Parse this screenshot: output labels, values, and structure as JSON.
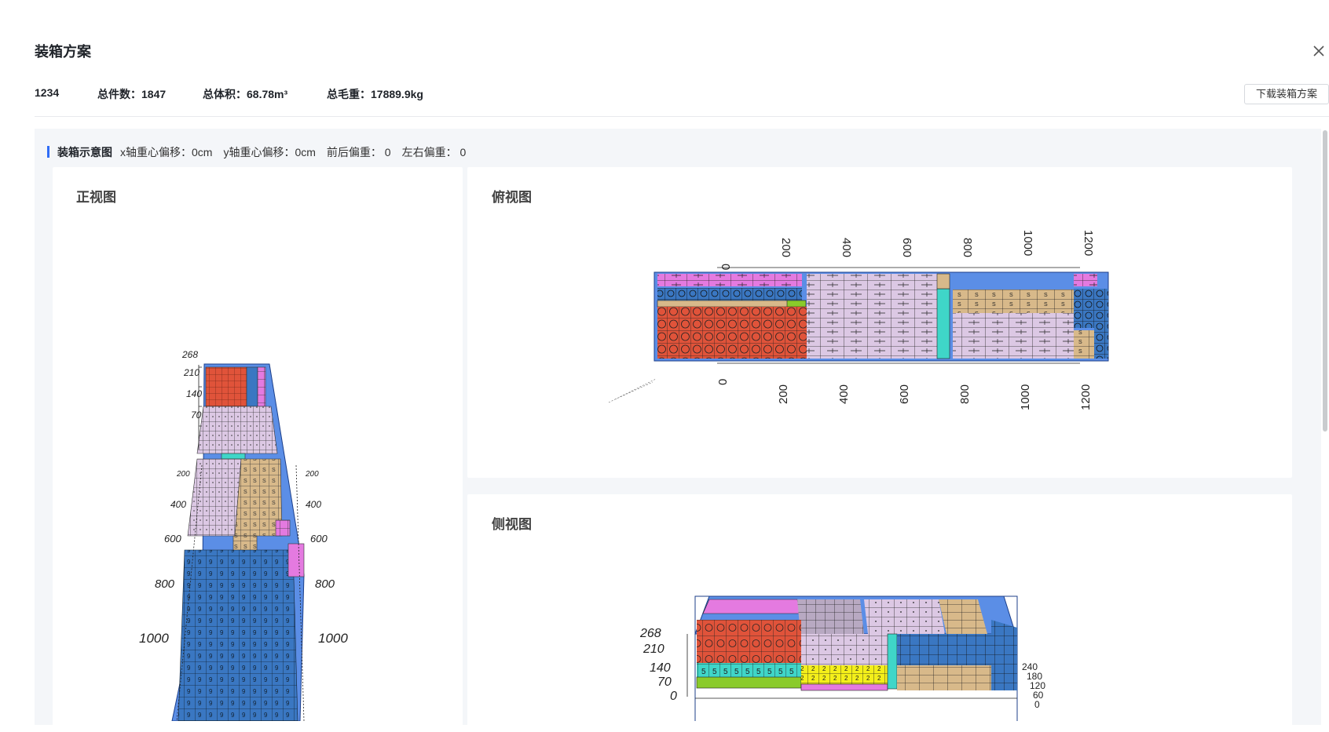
{
  "dialog": {
    "title": "装箱方案",
    "download_label": "下载装箱方案"
  },
  "stats": {
    "id": "1234",
    "total_pieces": "总件数：1847",
    "total_volume": "总体积：68.78m³",
    "gross_weight": "总毛重：17889.9kg"
  },
  "diagram_section": {
    "heading": "装箱示意图",
    "x_offset": "x轴重心偏移：0cm",
    "y_offset": "y轴重心偏移：0cm",
    "front_back": "前后偏重： 0",
    "left_right": "左右偏重： 0"
  },
  "views": {
    "front": "正视图",
    "top": "俯视图",
    "side": "侧视图"
  },
  "axis_labels": {
    "length": [
      "0",
      "200",
      "400",
      "600",
      "800",
      "1000",
      "1200"
    ],
    "height": [
      "268",
      "210",
      "140",
      "70",
      "0"
    ],
    "width": [
      "240",
      "180",
      "120",
      "60",
      "0"
    ]
  },
  "colors": {
    "accent": "#2f6cf6",
    "cargo_red": "#e0533a",
    "cargo_pink": "#e47ae0",
    "cargo_blue": "#3a77c2",
    "cargo_lilac": "#dcc8e4",
    "cargo_tan": "#d8b98a",
    "cargo_cyan": "#3fd6c8",
    "cargo_yellow": "#f4ef1a",
    "cargo_green": "#8acb2a",
    "container": "#5b8ee6"
  }
}
